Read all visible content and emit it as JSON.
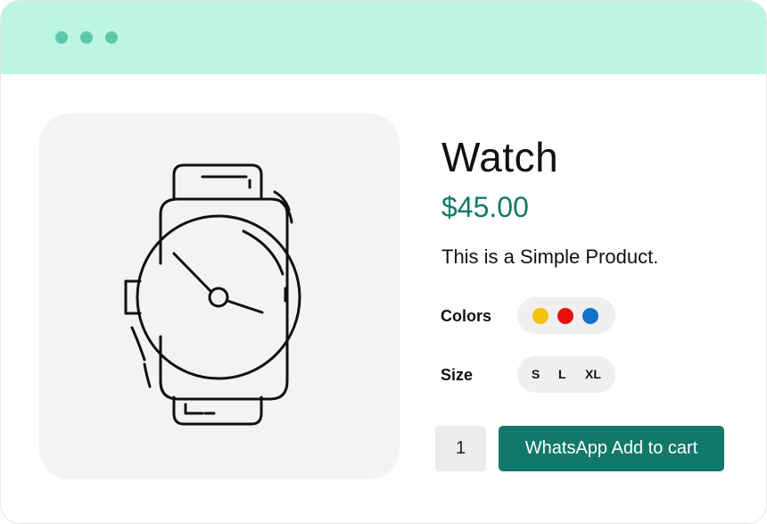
{
  "product": {
    "title": "Watch",
    "price": "$45.00",
    "description": "This is a Simple Product."
  },
  "options": {
    "colors_label": "Colors",
    "colors": [
      {
        "name": "yellow",
        "hex": "#f6c20a"
      },
      {
        "name": "red",
        "hex": "#e8100f"
      },
      {
        "name": "blue",
        "hex": "#1473c9"
      }
    ],
    "size_label": "Size",
    "sizes": [
      "S",
      "L",
      "XL"
    ]
  },
  "cart": {
    "quantity": "1",
    "button_label": "WhatsApp Add to cart"
  },
  "theme": {
    "titlebar_color": "#bdf5e3",
    "dot_color": "#5ec8ad",
    "accent": "#11786a",
    "price_color": "#0f7a6a"
  },
  "image": {
    "icon": "watch-icon"
  }
}
